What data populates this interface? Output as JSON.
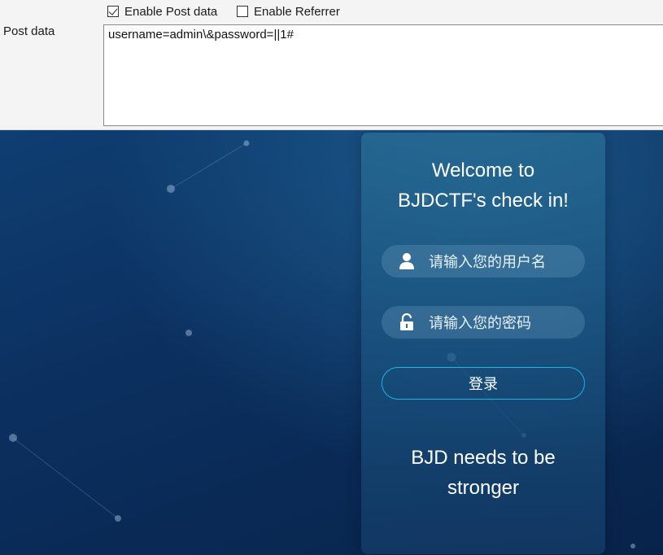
{
  "hackbar": {
    "enable_post_label": "Enable Post data",
    "enable_post_checked": true,
    "enable_referrer_label": "Enable Referrer",
    "enable_referrer_checked": false,
    "post_data_label": "Post data",
    "post_data_value": "username=admin\\&password=||1#"
  },
  "login": {
    "welcome_line1": "Welcome to",
    "welcome_line2": "BJDCTF's check in!",
    "username_placeholder": "请输入您的用户名",
    "password_placeholder": "请输入您的密码",
    "login_button": "登录",
    "slogan_line1": "BJD needs to be",
    "slogan_line2": "stronger",
    "user_icon": "user-icon",
    "lock_icon": "lock-icon"
  },
  "colors": {
    "accent_border": "#19b7e8",
    "background_dark": "#0b2f5e"
  }
}
